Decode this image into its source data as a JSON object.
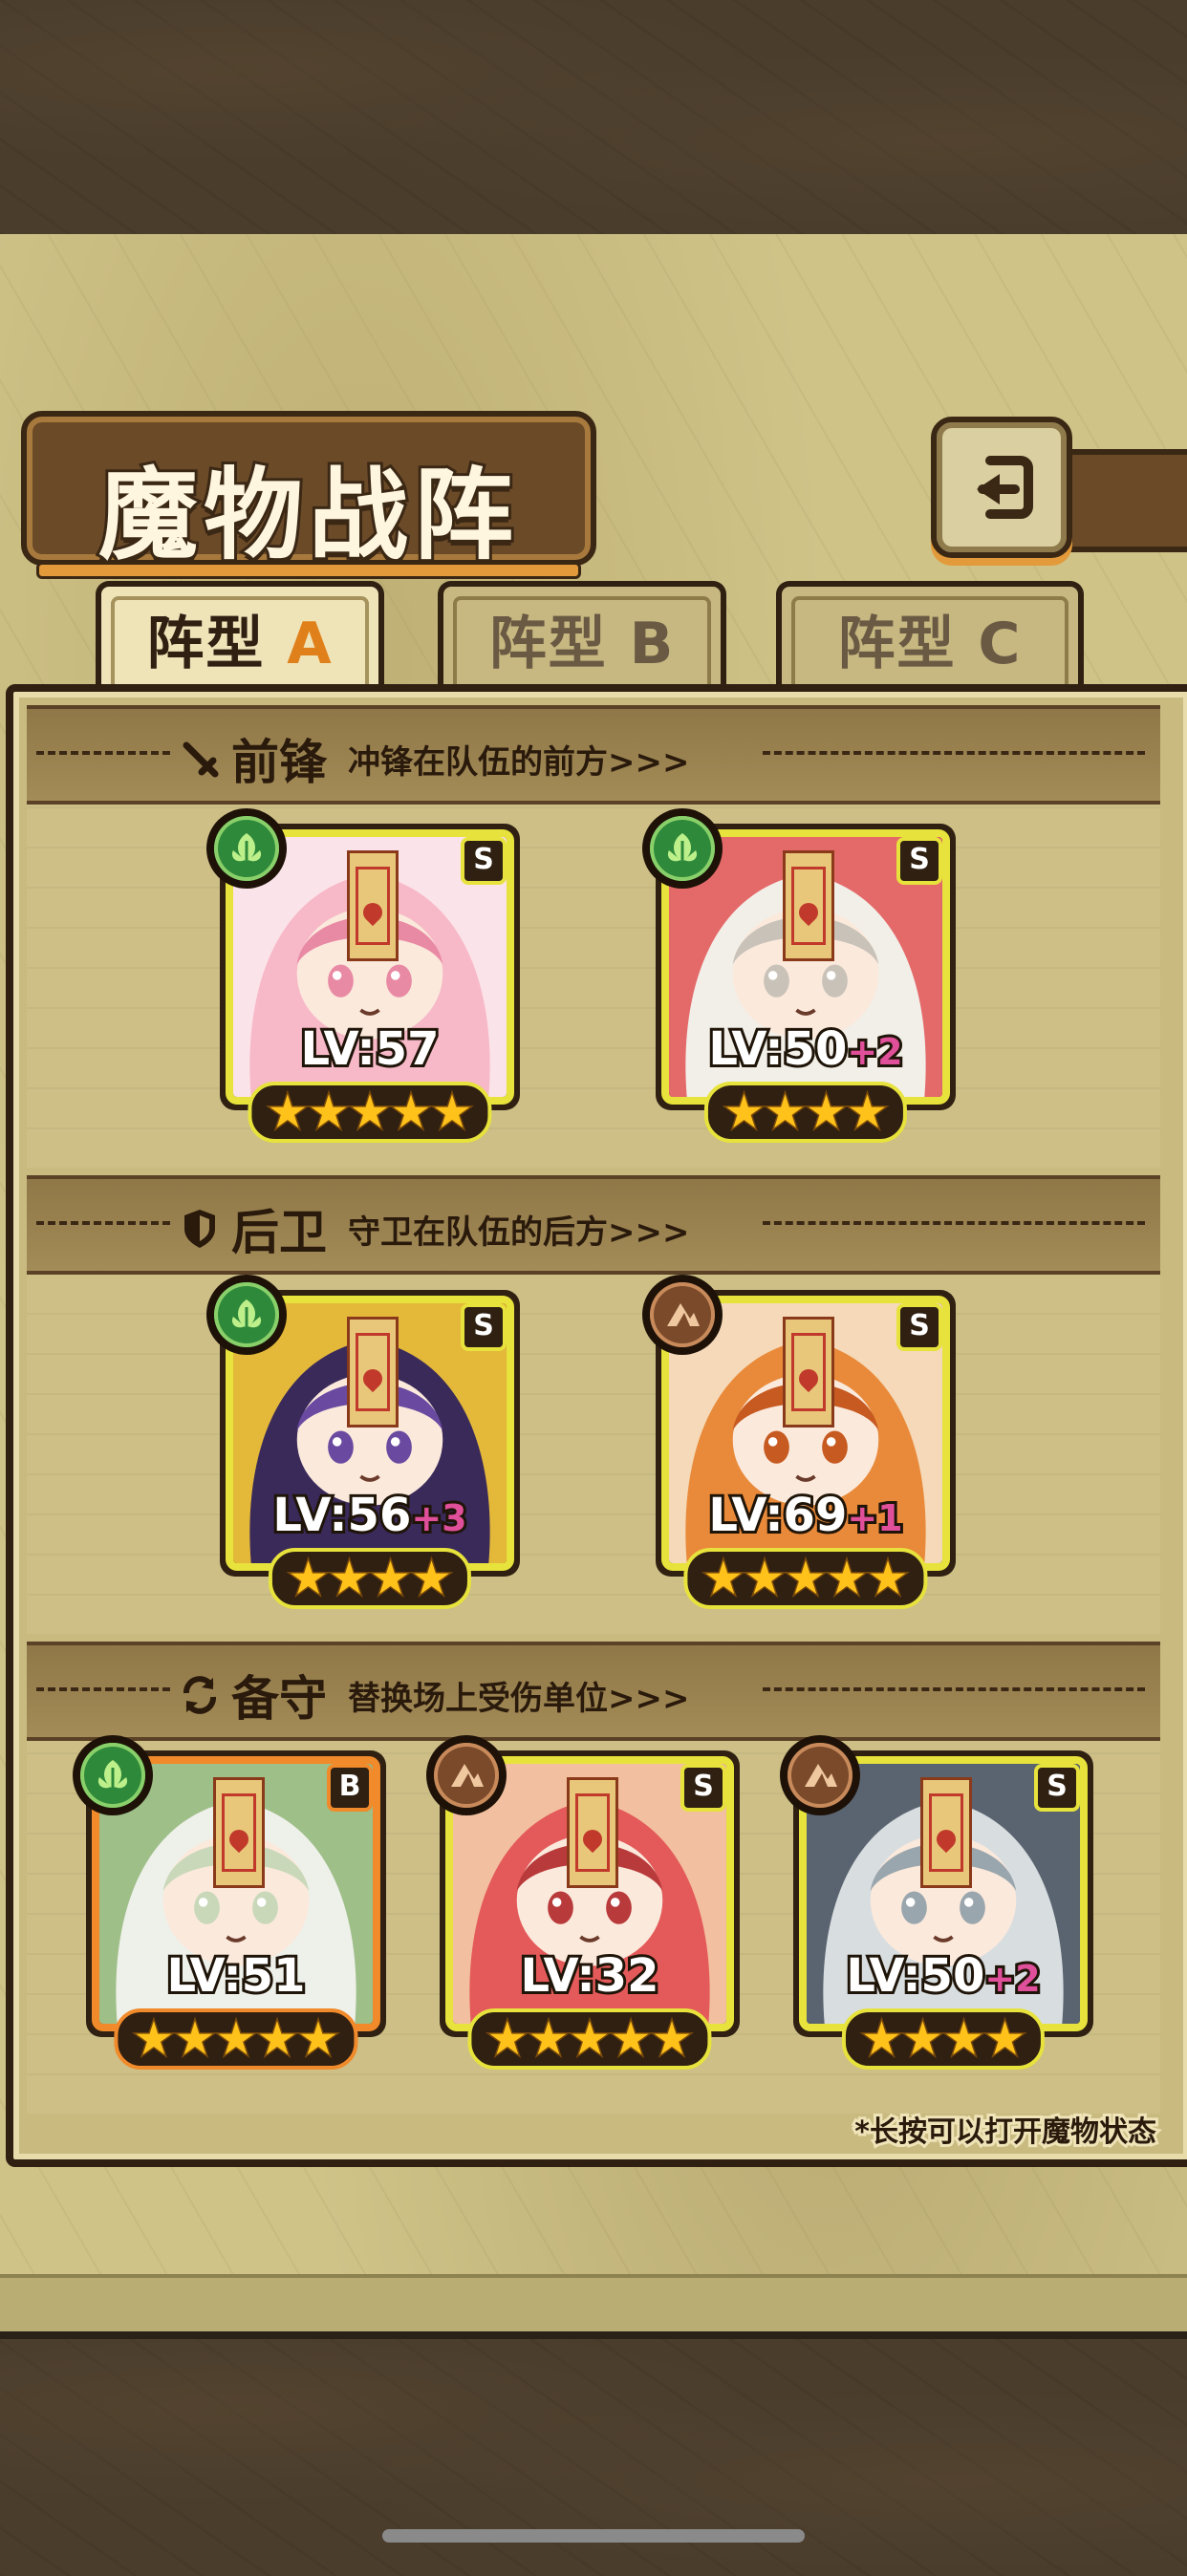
{
  "title": "魔物战阵",
  "back_button": {
    "icon": "return-arrow-icon"
  },
  "tabs": [
    {
      "prefix": "阵型",
      "letter": "A",
      "active": true
    },
    {
      "prefix": "阵型",
      "letter": "B",
      "active": false
    },
    {
      "prefix": "阵型",
      "letter": "C",
      "active": false
    }
  ],
  "sections": [
    {
      "name": "前锋",
      "desc": "冲锋在队伍的前方>>>",
      "icon": "sword-icon"
    },
    {
      "name": "后卫",
      "desc": "守卫在队伍的后方>>>",
      "icon": "shield-icon"
    },
    {
      "name": "备守",
      "desc": "替换场上受伤单位>>>",
      "icon": "swap-icon"
    }
  ],
  "monsters": {
    "front": [
      {
        "rank": "S",
        "element": "leaf-icon",
        "level": "LV:57",
        "plus": "",
        "stars": 5,
        "palette": [
          "#f7b9c8",
          "#e98aa5",
          "#fbe3ea"
        ]
      },
      {
        "rank": "S",
        "element": "leaf-icon",
        "level": "LV:50",
        "plus": "+2",
        "stars": 4,
        "palette": [
          "#f2efe9",
          "#c9c2b8",
          "#e46a6a"
        ]
      }
    ],
    "back": [
      {
        "rank": "S",
        "element": "leaf-icon",
        "level": "LV:56",
        "plus": "+3",
        "stars": 4,
        "palette": [
          "#3a2a5a",
          "#6a4aa0",
          "#e4b93a"
        ]
      },
      {
        "rank": "S",
        "element": "mountain-icon",
        "level": "LV:69",
        "plus": "+1",
        "stars": 5,
        "palette": [
          "#e98a3a",
          "#c65a20",
          "#f5d9b8"
        ]
      }
    ],
    "reserve": [
      {
        "rank": "B",
        "element": "leaf-icon",
        "level": "LV:51",
        "plus": "",
        "stars": 5,
        "palette": [
          "#eef0ea",
          "#c8d8b8",
          "#9fbf88"
        ]
      },
      {
        "rank": "S",
        "element": "mountain-icon",
        "level": "LV:32",
        "plus": "",
        "stars": 5,
        "palette": [
          "#e45a5a",
          "#b83a3a",
          "#f2c0a0"
        ]
      },
      {
        "rank": "S",
        "element": "mountain-icon",
        "level": "LV:50",
        "plus": "+2",
        "stars": 4,
        "palette": [
          "#d8dde0",
          "#9aa6ad",
          "#5a6470"
        ]
      }
    ]
  },
  "hint": "*长按可以打开魔物状态",
  "colors": {
    "frame_s": "#e7e23c",
    "frame_b": "#f08a2a",
    "star": "#ffc21a",
    "plus": "#e0509a",
    "accent": "#e0801a"
  }
}
